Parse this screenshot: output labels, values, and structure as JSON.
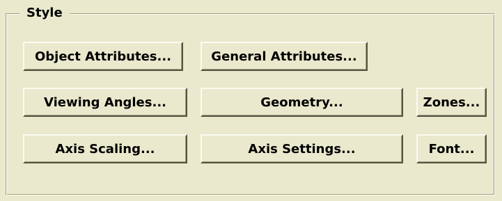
{
  "style_group": {
    "title": "Style",
    "buttons": {
      "object_attributes": "Object Attributes...",
      "general_attributes": "General Attributes...",
      "viewing_angles": "Viewing Angles...",
      "geometry": "Geometry...",
      "zones": "Zones...",
      "axis_scaling": "Axis Scaling...",
      "axis_settings": "Axis Settings...",
      "font": "Font..."
    }
  }
}
